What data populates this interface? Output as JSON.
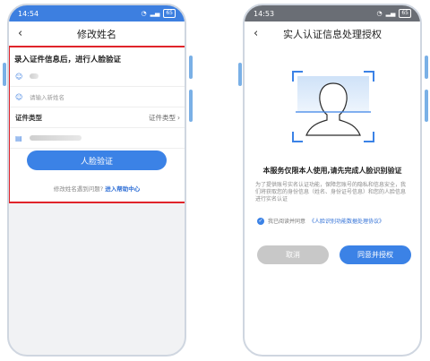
{
  "left_screen": {
    "status_time": "14:54",
    "status_battery": "65",
    "title": "修改姓名",
    "form_header": "录入证件信息后，进行人脸验证",
    "new_name_placeholder": "请输入新姓名",
    "id_type_label": "证件类型",
    "id_type_value": "证件类型",
    "verify_button": "人脸验证",
    "help_prefix": "修改姓名遇到问题?",
    "help_link": "进入帮助中心"
  },
  "right_screen": {
    "status_time": "14:53",
    "status_battery": "65",
    "title": "实人认证信息处理授权",
    "main_title": "本服务仅限本人使用,请先完成人脸识别验证",
    "description": "为了提供账号实名认证功能，保障您账号的隐私和信息安全，我们将获取您的身份信息（姓名、身份证号信息）和您的人脸信息进行实名认证",
    "agree_prefix": "我已阅读并同意",
    "agree_link": "《人脸识别功能数据处理协议》",
    "cancel_button": "取消",
    "confirm_button": "同意并授权"
  },
  "colors": {
    "accent": "#3b82e6",
    "highlight_border": "#e0242a"
  }
}
